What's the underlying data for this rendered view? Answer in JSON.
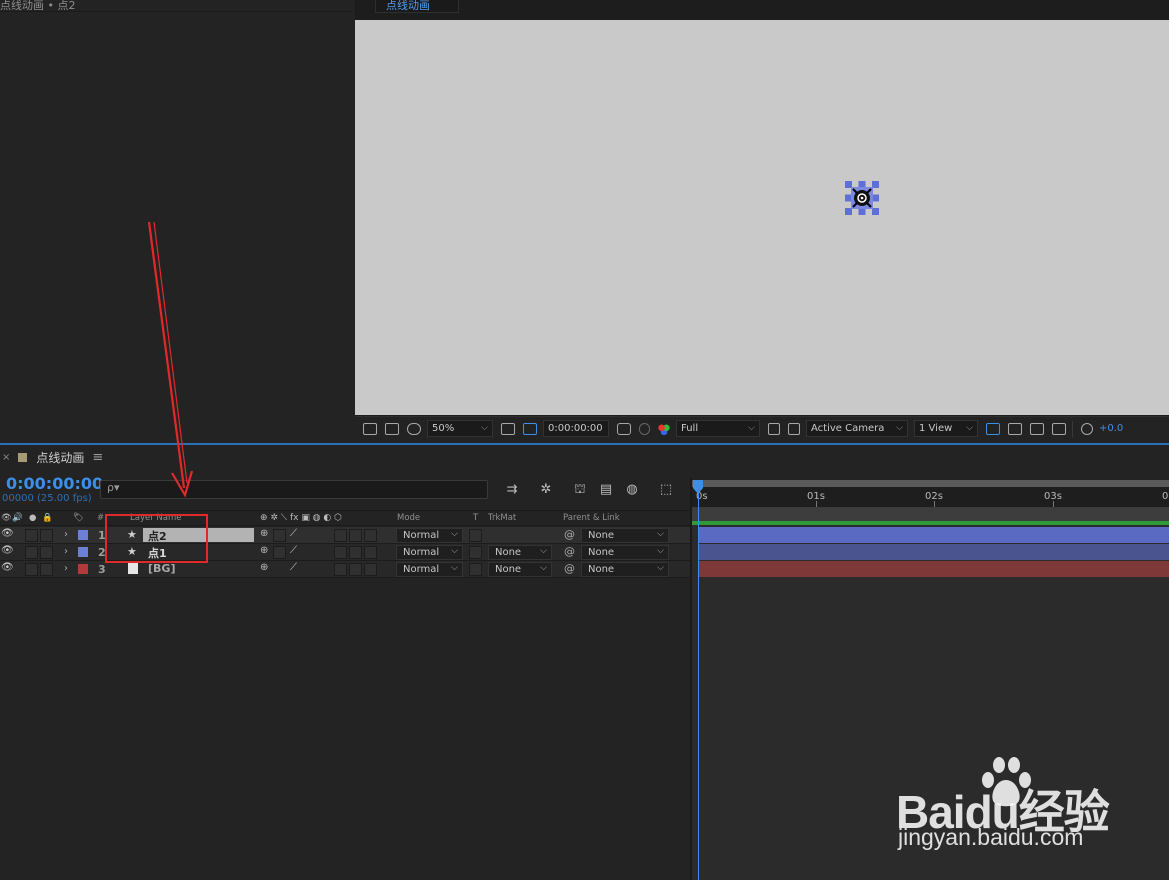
{
  "effect_panel": {
    "title": "点线动画 • 点2"
  },
  "viewer": {
    "tab_label": "点线动画",
    "zoom": "50%",
    "timecode": "0:00:00:00",
    "resolution": "Full",
    "camera": "Active Camera",
    "views": "1 View",
    "exposure": "+0.0"
  },
  "timeline": {
    "tab_title": "点线动画",
    "current_time": "0:00:00:00",
    "frame_info": "00000 (25.00 fps)",
    "search_placeholder": "ρ▾",
    "columns": {
      "num": "#",
      "layer_name": "Layer Name",
      "mode": "Mode",
      "t": "T",
      "trkmat": "TrkMat",
      "parent": "Parent & Link"
    },
    "ruler_labels": [
      "0s",
      "01s",
      "02s",
      "03s",
      "0"
    ],
    "layers": [
      {
        "num": "1",
        "name": "点2",
        "label_color": "#6e7fd6",
        "mode": "Normal",
        "trkmat": "",
        "parent": "None",
        "bar_color": "#5a6ac2"
      },
      {
        "num": "2",
        "name": "点1",
        "label_color": "#6e7fd6",
        "mode": "Normal",
        "trkmat": "None",
        "parent": "None",
        "bar_color": "#4a5590"
      },
      {
        "num": "3",
        "name": "[BG]",
        "label_color": "#b33a3a",
        "mode": "Normal",
        "trkmat": "None",
        "parent": "None",
        "bar_color": "#7e3838"
      }
    ]
  },
  "watermark": {
    "logo": "Baidu经验",
    "url": "jingyan.baidu.com"
  }
}
